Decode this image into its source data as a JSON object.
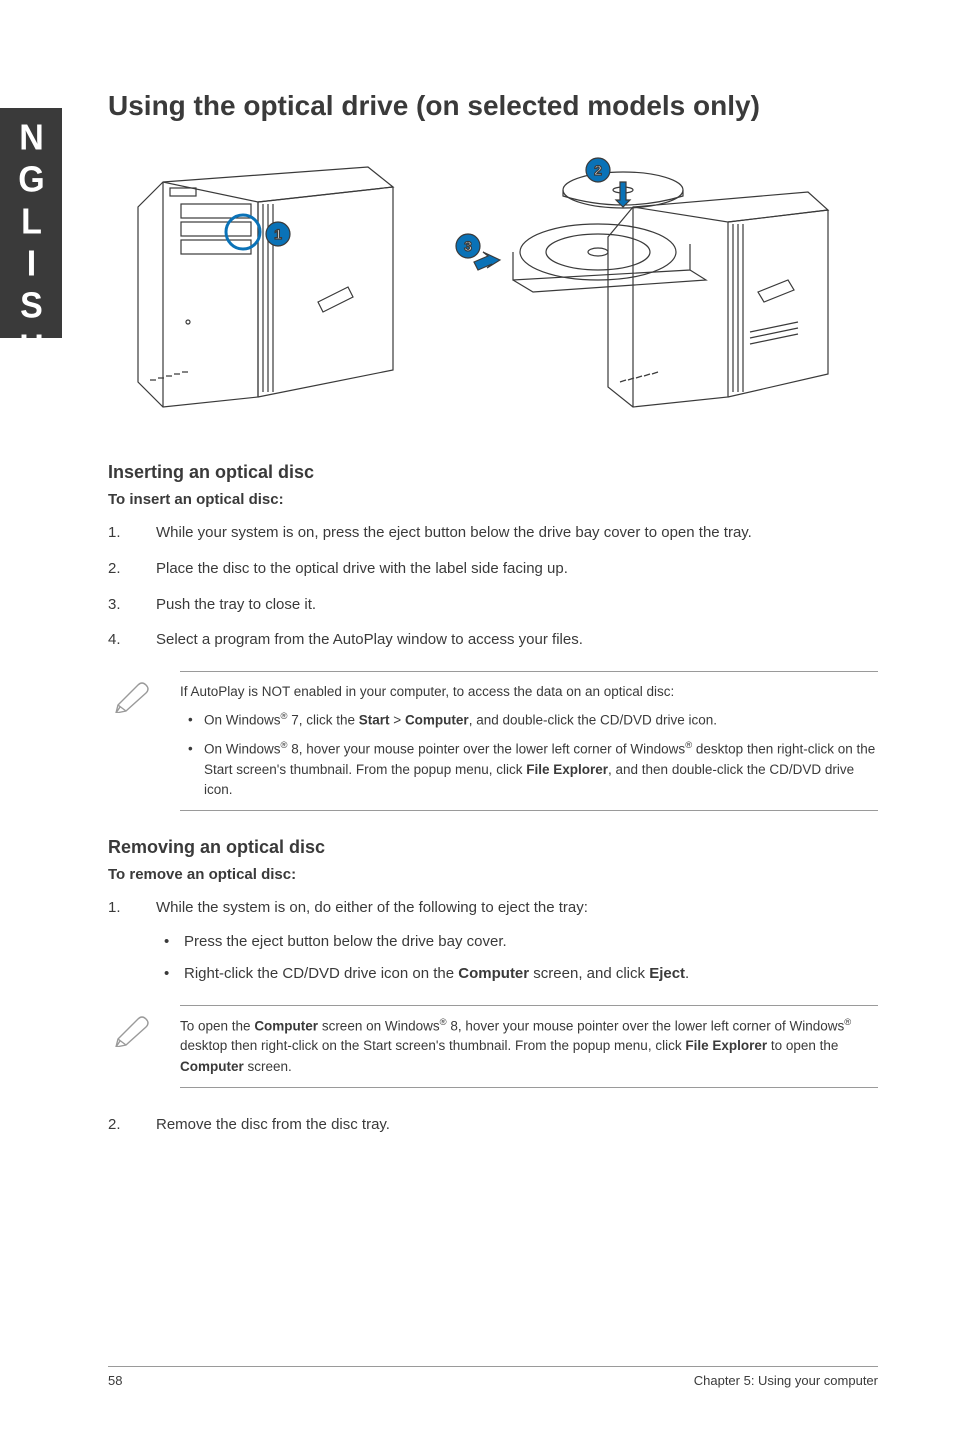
{
  "sideTab": "ENGLISH",
  "h1": "Using the optical drive (on selected models only)",
  "callouts": {
    "c1": "1",
    "c2": "2",
    "c3": "3"
  },
  "insert": {
    "heading": "Inserting an optical disc",
    "sub": "To insert an optical disc:",
    "steps": [
      "While your system is on, press the eject button below the drive bay cover to open the tray.",
      "Place the disc to the optical drive with the label side facing up.",
      "Push the tray to close it.",
      "Select a program from the AutoPlay window to access your files."
    ]
  },
  "note1": {
    "lead": "If AutoPlay is NOT enabled in your computer, to access the data on an optical disc:",
    "b1a": "On Windows",
    "b1b": " 7, click the ",
    "b1c": "Start",
    "b1d": " > ",
    "b1e": "Computer",
    "b1f": ", and double-click the CD/DVD drive icon.",
    "b2a": "On Windows",
    "b2b": " 8, hover your mouse pointer over the lower left corner of Windows",
    "b2c": " desktop then right-click on the Start screen's thumbnail. From the popup menu, click ",
    "b2d": "File Explorer",
    "b2e": ", and then double-click the CD/DVD drive icon."
  },
  "remove": {
    "heading": "Removing an optical disc",
    "sub": "To remove an optical disc:",
    "step1": "While the system is on, do either of the following to eject the tray:",
    "bullet1": "Press the eject button below the drive bay cover.",
    "bullet2a": "Right-click the CD/DVD drive icon on the ",
    "bullet2b": "Computer",
    "bullet2c": " screen, and click ",
    "bullet2d": "Eject",
    "bullet2e": ".",
    "step2": "Remove the disc from the disc tray."
  },
  "note2": {
    "t1": "To open the ",
    "t2": "Computer",
    "t3": " screen on Windows",
    "t4": " 8, hover your mouse pointer over the lower left corner of Windows",
    "t5": " desktop then right-click on the Start screen's thumbnail. From the popup menu, click ",
    "t6": "File Explorer",
    "t7": " to open the ",
    "t8": "Computer",
    "t9": " screen."
  },
  "footer": {
    "page": "58",
    "chapter": "Chapter 5: Using your computer"
  },
  "reg": "®"
}
